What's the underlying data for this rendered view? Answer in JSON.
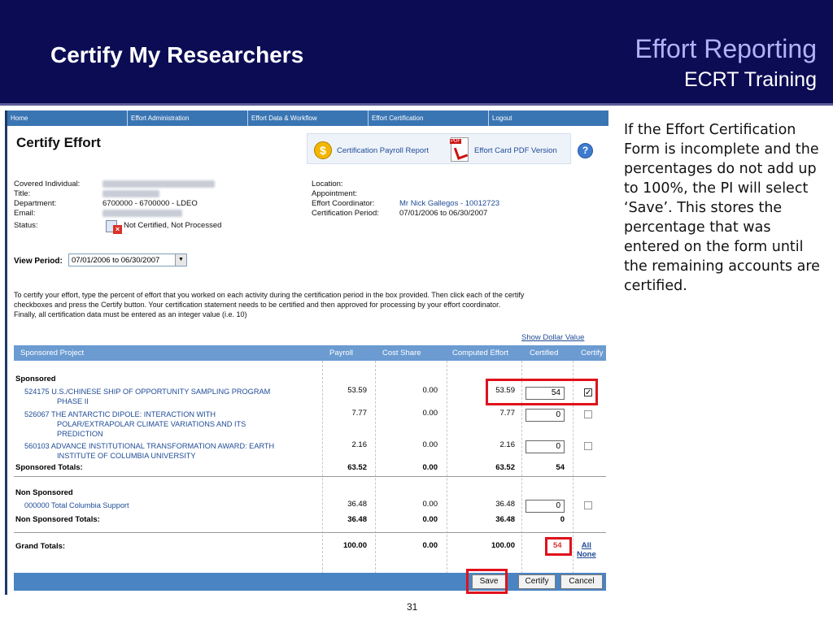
{
  "slide": {
    "title": "Certify My Researchers",
    "header_right_1": "Effort Reporting",
    "header_right_2": "ECRT Training",
    "page_number": "31",
    "side_text": "If the Effort Certification Form is incomplete and the percentages do not add up to 100%, the PI will select ‘Save’. This stores the percentage that was entered on the form until the remaining accounts are certified."
  },
  "nav": [
    "Home",
    "Effort Administration",
    "Effort Data & Workflow",
    "Effort Certification",
    "Logout"
  ],
  "page": {
    "title": "Certify Effort",
    "toolbar_link_1": "Certification Payroll Report",
    "toolbar_link_2": "Effort Card PDF Version"
  },
  "fields": {
    "covered_label": "Covered Individual:",
    "title_label": "Title:",
    "department_label": "Department:",
    "department_value": "6700000 - 6700000 - LDEO",
    "email_label": "Email:",
    "status_label": "Status:",
    "status_value": "Not Certified, Not Processed",
    "location_label": "Location:",
    "appointment_label": "Appointment:",
    "coordinator_label": "Effort Coordinator:",
    "coordinator_value": "Mr Nick Gallegos - 10012723",
    "period_label": "Certification Period:",
    "period_value": "07/01/2006 to 06/30/2007"
  },
  "view_period": {
    "label": "View Period:",
    "value": "07/01/2006 to 06/30/2007"
  },
  "instructions": [
    "To certify your effort, type the percent of effort that you worked on each activity during the certification period in the box provided. Then click each of the certify",
    "checkboxes and press the Certify button. Your certification statement needs to be certified and then approved for processing by your effort coordinator.",
    "Finally, all certification data must be entered as an integer value (i.e. 10)"
  ],
  "table": {
    "show_dollar_link": "Show Dollar Value",
    "headers": [
      "Sponsored Project",
      "Payroll",
      "Cost Share",
      "Computed Effort",
      "Certified",
      "Certify"
    ],
    "sponsored_label": "Sponsored",
    "sponsored_rows": [
      {
        "line1": "524175 U.S./CHINESE SHIP OF OPPORTUNITY SAMPLING PROGRAM",
        "line2": "PHASE II",
        "line3": "",
        "payroll": "53.59",
        "cost_share": "0.00",
        "computed": "53.59",
        "certified": "54",
        "checked": true
      },
      {
        "line1": "526067 THE ANTARCTIC DIPOLE: INTERACTION WITH",
        "line2": "POLAR/EXTRAPOLAR CLIMATE VARIATIONS AND ITS",
        "line3": "PREDICTION",
        "payroll": "7.77",
        "cost_share": "0.00",
        "computed": "7.77",
        "certified": "0",
        "checked": false
      },
      {
        "line1": "560103 ADVANCE INSTITUTIONAL TRANSFORMATION AWARD: EARTH",
        "line2": "INSTITUTE OF COLUMBIA UNIVERSITY",
        "line3": "",
        "payroll": "2.16",
        "cost_share": "0.00",
        "computed": "2.16",
        "certified": "0",
        "checked": false
      }
    ],
    "sponsored_totals": {
      "label": "Sponsored Totals:",
      "payroll": "63.52",
      "cost_share": "0.00",
      "computed": "63.52",
      "certified": "54"
    },
    "non_sponsored_label": "Non Sponsored",
    "non_sponsored_row": {
      "line1": "000000 Total Columbia Support",
      "payroll": "36.48",
      "cost_share": "0.00",
      "computed": "36.48",
      "certified": "0",
      "checked": false
    },
    "non_sponsored_totals": {
      "label": "Non Sponsored Totals:",
      "payroll": "36.48",
      "cost_share": "0.00",
      "computed": "36.48",
      "certified": "0"
    },
    "grand_totals": {
      "label": "Grand Totals:",
      "payroll": "100.00",
      "cost_share": "0.00",
      "computed": "100.00",
      "certified": "54"
    },
    "all_link": "All",
    "none_link": "None"
  },
  "buttons": {
    "save": "Save",
    "certify": "Certify",
    "cancel": "Cancel"
  },
  "colors": {
    "header_bg": "#0c0c55",
    "nav_bg": "#3a75b3",
    "table_header_bg": "#6b9bd1",
    "highlight": "#e0111b"
  }
}
